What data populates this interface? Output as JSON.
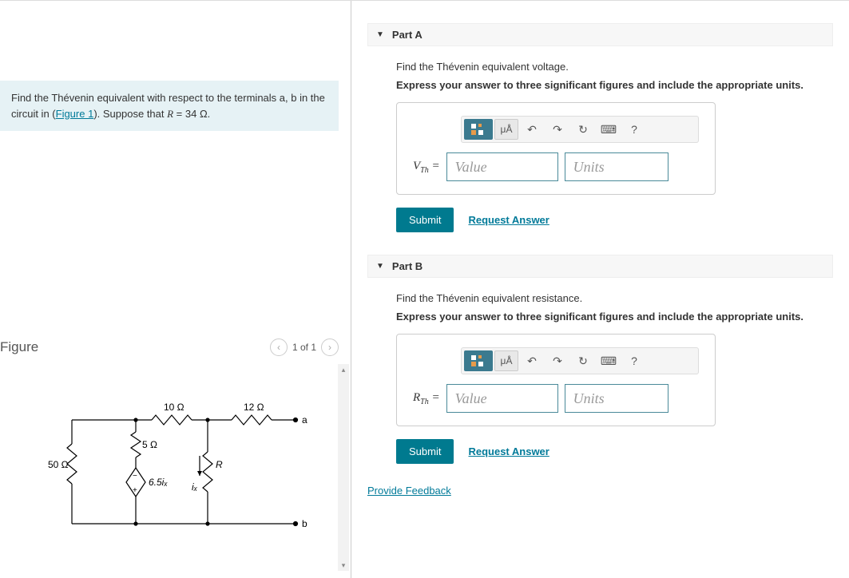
{
  "problem": {
    "text_before": "Find the Thévenin equivalent with respect to the terminals a, b in the circuit in (",
    "figure_link": "Figure 1",
    "text_after": "). Suppose that ",
    "var": "R",
    "equals": " = 34 Ω."
  },
  "figure": {
    "title": "Figure",
    "nav_text": "1 of 1",
    "labels": {
      "r50": "50 Ω",
      "r10": "10 Ω",
      "r5": "5 Ω",
      "r12": "12 Ω",
      "src": "6.5iₓ",
      "rR": "R",
      "ix": "iₓ",
      "a": "a",
      "b": "b"
    }
  },
  "parts": [
    {
      "label": "Part A",
      "prompt": "Find the Thévenin equivalent voltage.",
      "instruct": "Express your answer to three significant figures and include the appropriate units.",
      "var_html": "V",
      "var_sub": "Th",
      "value_ph": "Value",
      "units_ph": "Units",
      "submit": "Submit",
      "request": "Request Answer"
    },
    {
      "label": "Part B",
      "prompt": "Find the Thévenin equivalent resistance.",
      "instruct": "Express your answer to three significant figures and include the appropriate units.",
      "var_html": "R",
      "var_sub": "Th",
      "value_ph": "Value",
      "units_ph": "Units",
      "submit": "Submit",
      "request": "Request Answer"
    }
  ],
  "toolbar": {
    "units_btn": "μÅ",
    "help": "?"
  },
  "feedback": "Provide Feedback"
}
